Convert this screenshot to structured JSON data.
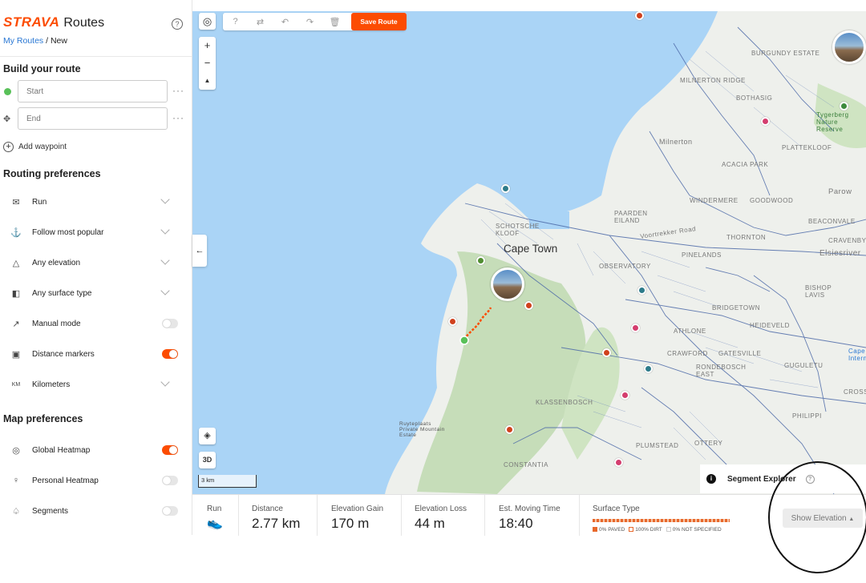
{
  "brand": {
    "logo": "STRAVA",
    "title": "Routes",
    "help_icon": "question-circle-icon"
  },
  "breadcrumb": {
    "parent": "My Routes",
    "separator": " / ",
    "current": "New"
  },
  "build": {
    "heading": "Build your route",
    "start_placeholder": "Start",
    "end_placeholder": "End",
    "more": "···",
    "add_waypoint": "Add waypoint"
  },
  "routing": {
    "heading": "Routing preferences",
    "items": [
      {
        "icon": "shoe-icon",
        "glyph": "✉",
        "label": "Run",
        "control": "chevron"
      },
      {
        "icon": "popularity-icon",
        "glyph": "⚓",
        "label": "Follow most popular",
        "control": "chevron"
      },
      {
        "icon": "elevation-icon",
        "glyph": "△",
        "label": "Any elevation",
        "control": "chevron"
      },
      {
        "icon": "surface-icon",
        "glyph": "◧",
        "label": "Any surface type",
        "control": "chevron"
      },
      {
        "icon": "manual-icon",
        "glyph": "↗",
        "label": "Manual mode",
        "control": "toggle",
        "on": false
      },
      {
        "icon": "marker-icon",
        "glyph": "▣",
        "label": "Distance markers",
        "control": "toggle",
        "on": true
      },
      {
        "icon": "km-icon",
        "glyph": "KM",
        "label": "Kilometers",
        "control": "chevron"
      }
    ]
  },
  "map_prefs": {
    "heading": "Map preferences",
    "items": [
      {
        "icon": "globe-icon",
        "glyph": "◎",
        "label": "Global Heatmap",
        "on": true
      },
      {
        "icon": "person-icon",
        "glyph": "♀",
        "label": "Personal Heatmap",
        "on": false
      },
      {
        "icon": "segment-icon",
        "glyph": "♤",
        "label": "Segments",
        "on": false
      }
    ]
  },
  "toolbar": {
    "save_label": "Save Route",
    "zoom_in": "+",
    "zoom_out": "−",
    "north": "▲",
    "layers": "◈",
    "three_d": "3D",
    "collapse": "←"
  },
  "map": {
    "city": "Cape Town",
    "labels": [
      "BURGUNDY ESTATE",
      "MILNERTON RIDGE",
      "BOTHASIG",
      "Milnerton",
      "PLATTEKLOOF",
      "ACACIA PARK",
      "Tygerberg Nature Reserve",
      "Parow",
      "WINDERMERE",
      "GOODWOOD",
      "PAARDEN EILAND",
      "Voortrekker Road",
      "THORNTON",
      "BEACONVALE",
      "CRAVENBY",
      "Elsiesriver",
      "SCHOTSCHE KLOOF",
      "OBSERVATORY",
      "PINELANDS",
      "BISHOP LAVIS",
      "BRIDGETOWN",
      "ATHLONE",
      "HEIDEVELD",
      "CRAWFORD",
      "GATESVILLE",
      "RONDEBOSCH EAST",
      "GUGULETU",
      "Cape International",
      "CROSSR",
      "PHILIPPI",
      "KLASSENBOSCH",
      "Ruyteplaats Private Mountain Estate",
      "OTTERY",
      "PLUMSTEAD",
      "CONSTANTIA"
    ],
    "scale": "3 km",
    "segment_explorer": "Segment Explorer"
  },
  "stats": {
    "activity_label": "Run",
    "distance_label": "Distance",
    "distance": "2.77 km",
    "gain_label": "Elevation Gain",
    "gain": "170 m",
    "loss_label": "Elevation Loss",
    "loss": "44 m",
    "time_label": "Est. Moving Time",
    "time": "18:40",
    "surface_label": "Surface Type",
    "legend_paved": "0% PAVED",
    "legend_dirt": "100% DIRT",
    "legend_unspecified": "0% NOT SPECIFIED",
    "show_elevation": "Show Elevation"
  },
  "colors": {
    "accent": "#fc4c02",
    "water": "#a9d3f5",
    "land": "#eef0ec",
    "roads": "#4d6aa8",
    "green": "#c8dfb8"
  }
}
